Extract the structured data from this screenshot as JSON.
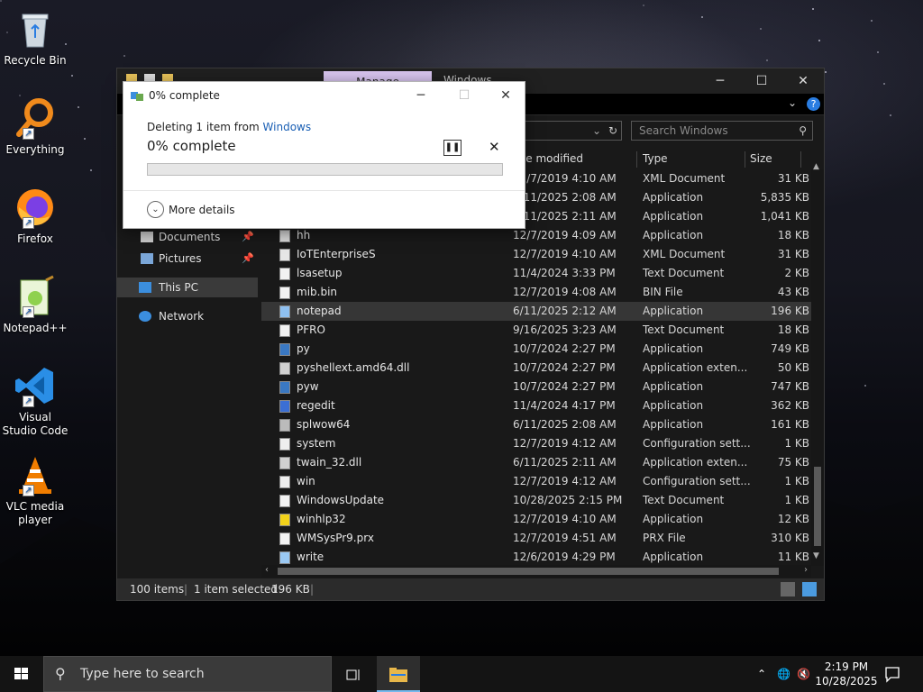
{
  "desktop": {
    "icons": [
      {
        "label": "Recycle Bin",
        "icon": "recycle-bin-icon"
      },
      {
        "label": "Everything",
        "icon": "everything-search-icon"
      },
      {
        "label": "Firefox",
        "icon": "firefox-icon"
      },
      {
        "label": "Notepad++",
        "icon": "notepadpp-icon"
      },
      {
        "label": "Visual Studio Code",
        "icon": "vscode-icon"
      },
      {
        "label": "VLC media player",
        "icon": "vlc-icon"
      }
    ]
  },
  "explorer": {
    "manage_tab": "Manage",
    "title": "Windows",
    "search_placeholder": "Search Windows",
    "columns": {
      "date": "Date modified",
      "type": "Type",
      "size": "Size"
    },
    "nav": [
      {
        "label": "Documents",
        "pinned": true
      },
      {
        "label": "Pictures",
        "pinned": true
      },
      {
        "label": "This PC",
        "pinned": false
      },
      {
        "label": "Network",
        "pinned": false
      }
    ],
    "rows": [
      {
        "name": "",
        "date": "12/7/2019 4:10 AM",
        "type": "XML Document",
        "size": "31 KB",
        "icon": "xml-file-icon"
      },
      {
        "name": "",
        "date": "6/11/2025 2:08 AM",
        "type": "Application",
        "size": "5,835 KB",
        "icon": "application-icon"
      },
      {
        "name": "",
        "date": "6/11/2025 2:11 AM",
        "type": "Application",
        "size": "1,041 KB",
        "icon": "application-icon"
      },
      {
        "name": "hh",
        "date": "12/7/2019 4:09 AM",
        "type": "Application",
        "size": "18 KB",
        "icon": "help-app-icon"
      },
      {
        "name": "IoTEnterpriseS",
        "date": "12/7/2019 4:10 AM",
        "type": "XML Document",
        "size": "31 KB",
        "icon": "xml-file-icon"
      },
      {
        "name": "lsasetup",
        "date": "11/4/2024 3:33 PM",
        "type": "Text Document",
        "size": "2 KB",
        "icon": "text-file-icon"
      },
      {
        "name": "mib.bin",
        "date": "12/7/2019 4:08 AM",
        "type": "BIN File",
        "size": "43 KB",
        "icon": "file-icon"
      },
      {
        "name": "notepad",
        "date": "6/11/2025 2:12 AM",
        "type": "Application",
        "size": "196 KB",
        "icon": "notepad-icon",
        "selected": true
      },
      {
        "name": "PFRO",
        "date": "9/16/2025 3:23 AM",
        "type": "Text Document",
        "size": "18 KB",
        "icon": "text-file-icon"
      },
      {
        "name": "py",
        "date": "10/7/2024 2:27 PM",
        "type": "Application",
        "size": "749 KB",
        "icon": "python-icon"
      },
      {
        "name": "pyshellext.amd64.dll",
        "date": "10/7/2024 2:27 PM",
        "type": "Application exten...",
        "size": "50 KB",
        "icon": "dll-icon"
      },
      {
        "name": "pyw",
        "date": "10/7/2024 2:27 PM",
        "type": "Application",
        "size": "747 KB",
        "icon": "python-icon"
      },
      {
        "name": "regedit",
        "date": "11/4/2024 4:17 PM",
        "type": "Application",
        "size": "362 KB",
        "icon": "regedit-icon"
      },
      {
        "name": "splwow64",
        "date": "6/11/2025 2:08 AM",
        "type": "Application",
        "size": "161 KB",
        "icon": "printer-app-icon"
      },
      {
        "name": "system",
        "date": "12/7/2019 4:12 AM",
        "type": "Configuration sett...",
        "size": "1 KB",
        "icon": "config-file-icon"
      },
      {
        "name": "twain_32.dll",
        "date": "6/11/2025 2:11 AM",
        "type": "Application exten...",
        "size": "75 KB",
        "icon": "dll-icon"
      },
      {
        "name": "win",
        "date": "12/7/2019 4:12 AM",
        "type": "Configuration sett...",
        "size": "1 KB",
        "icon": "config-file-icon"
      },
      {
        "name": "WindowsUpdate",
        "date": "10/28/2025 2:15 PM",
        "type": "Text Document",
        "size": "1 KB",
        "icon": "text-file-icon"
      },
      {
        "name": "winhlp32",
        "date": "12/7/2019 4:10 AM",
        "type": "Application",
        "size": "12 KB",
        "icon": "help-question-icon"
      },
      {
        "name": "WMSysPr9.prx",
        "date": "12/7/2019 4:51 AM",
        "type": "PRX File",
        "size": "310 KB",
        "icon": "file-icon"
      },
      {
        "name": "write",
        "date": "12/6/2019 4:29 PM",
        "type": "Application",
        "size": "11 KB",
        "icon": "wordpad-icon"
      }
    ],
    "status": {
      "items": "100 items",
      "selected": "1 item selected",
      "selected_size": "196 KB"
    }
  },
  "dialog": {
    "title": "0% complete",
    "sub_prefix": "Deleting 1 item from",
    "sub_link": "Windows",
    "big": "0% complete",
    "progress": 0,
    "more_details": "More details"
  },
  "taskbar": {
    "search_placeholder": "Type here to search",
    "time": "2:19 PM",
    "date": "10/28/2025"
  },
  "colors": {
    "accent": "#0078d7",
    "progress": "#06b025",
    "link": "#1a5fb4"
  }
}
